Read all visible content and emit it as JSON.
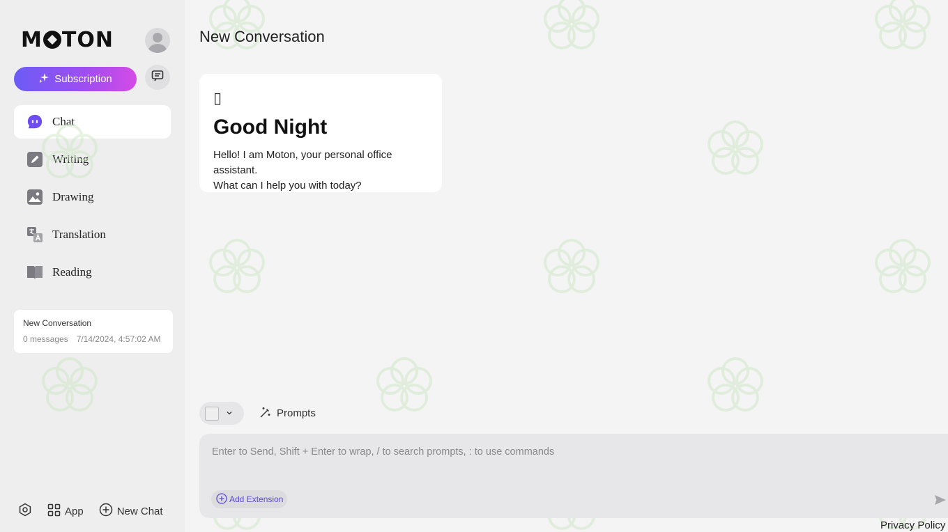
{
  "brand": {
    "logo_text": "MOTON"
  },
  "sidebar": {
    "subscription_label": "Subscription",
    "nav": [
      {
        "label": "Chat",
        "icon": "chat-bubble-icon",
        "active": true
      },
      {
        "label": "Writing",
        "icon": "pen-icon"
      },
      {
        "label": "Drawing",
        "icon": "image-icon"
      },
      {
        "label": "Translation",
        "icon": "translate-icon"
      },
      {
        "label": "Reading",
        "icon": "book-icon"
      }
    ],
    "conversations": [
      {
        "title": "New Conversation",
        "messages": "0 messages",
        "timestamp": "7/14/2024, 4:57:02 AM"
      }
    ],
    "footer": {
      "app_label": "App",
      "new_chat_label": "New Chat"
    }
  },
  "main": {
    "title": "New Conversation",
    "greeting": {
      "icon": "▯",
      "title": "Good Night",
      "line1": "Hello! I am Moton, your personal office assistant.",
      "line2": "What can I help you with today?"
    },
    "toolbar": {
      "prompts_label": "Prompts"
    },
    "input": {
      "placeholder": "Enter to Send, Shift + Enter to wrap, / to search prompts, : to use commands",
      "extension_label": "Add Extension"
    },
    "privacy_label": "Privacy Policy"
  },
  "colors": {
    "accent_start": "#6b5cf6",
    "accent_end": "#d44be6",
    "chat_icon": "#6d4df2",
    "extension_text": "#5b48d6",
    "watermark": "#cfe8c4"
  }
}
